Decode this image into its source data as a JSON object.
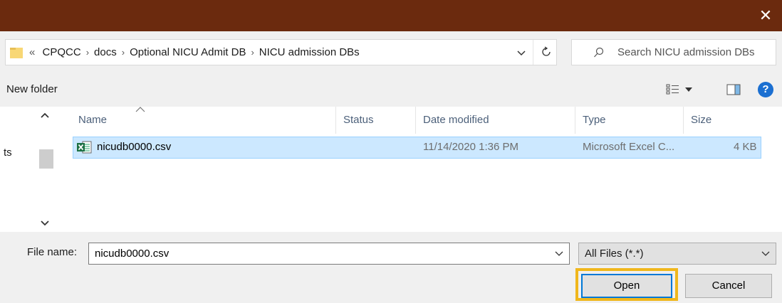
{
  "colors": {
    "titlebar": "#6b2a0e",
    "selection": "#cce8ff",
    "highlight": "#f0b71c",
    "accent": "#0078d7"
  },
  "titlebar": {
    "close_icon": "close-icon"
  },
  "address": {
    "overflow": "«",
    "crumbs": [
      "CPQCC",
      "docs",
      "Optional NICU Admit DB",
      "NICU admission DBs"
    ],
    "separator": "›"
  },
  "search": {
    "placeholder": "Search NICU admission DBs"
  },
  "toolbar": {
    "new_folder": "New folder",
    "help": "?"
  },
  "nav": {
    "partial_item": "ts"
  },
  "columns": [
    "Name",
    "Status",
    "Date modified",
    "Type",
    "Size"
  ],
  "files": [
    {
      "name": "nicudb0000.csv",
      "status": "",
      "date_modified": "11/14/2020 1:36 PM",
      "type": "Microsoft Excel C...",
      "size": "4 KB",
      "icon": "excel-csv-icon",
      "selected": true
    }
  ],
  "bottom": {
    "file_name_label": "File name:",
    "file_name_value": "nicudb0000.csv",
    "file_type": "All Files (*.*)",
    "open_label": "Open",
    "cancel_label": "Cancel"
  }
}
